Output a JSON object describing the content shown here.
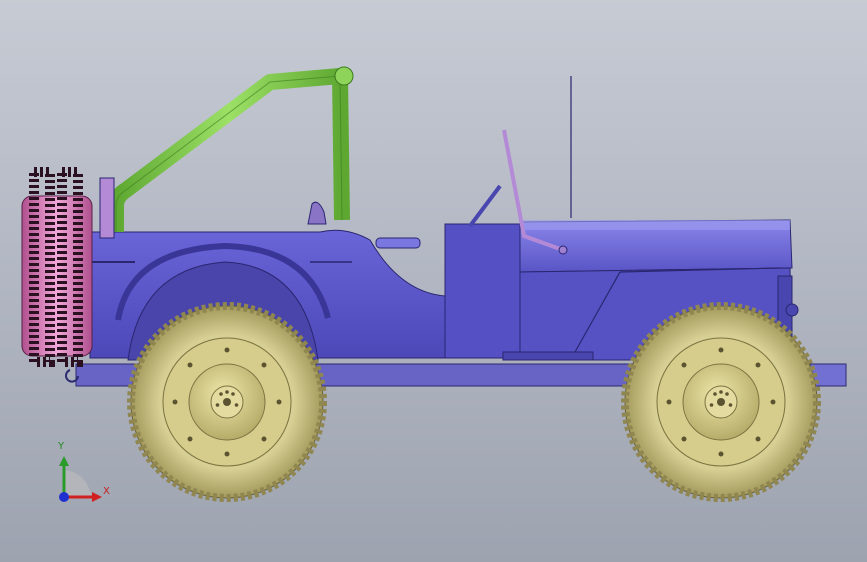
{
  "viewport": {
    "background": "#b6bbc6"
  },
  "triad": {
    "x_label": "X",
    "y_label": "Y"
  },
  "colors": {
    "body": "#5a55c6",
    "body_dark": "#3f3a9e",
    "rollbar": "#7cc84a",
    "tire": "#c9c082",
    "rim": "#d8cf8a",
    "spare": "#d883b8",
    "frame": "#6a66c8"
  }
}
